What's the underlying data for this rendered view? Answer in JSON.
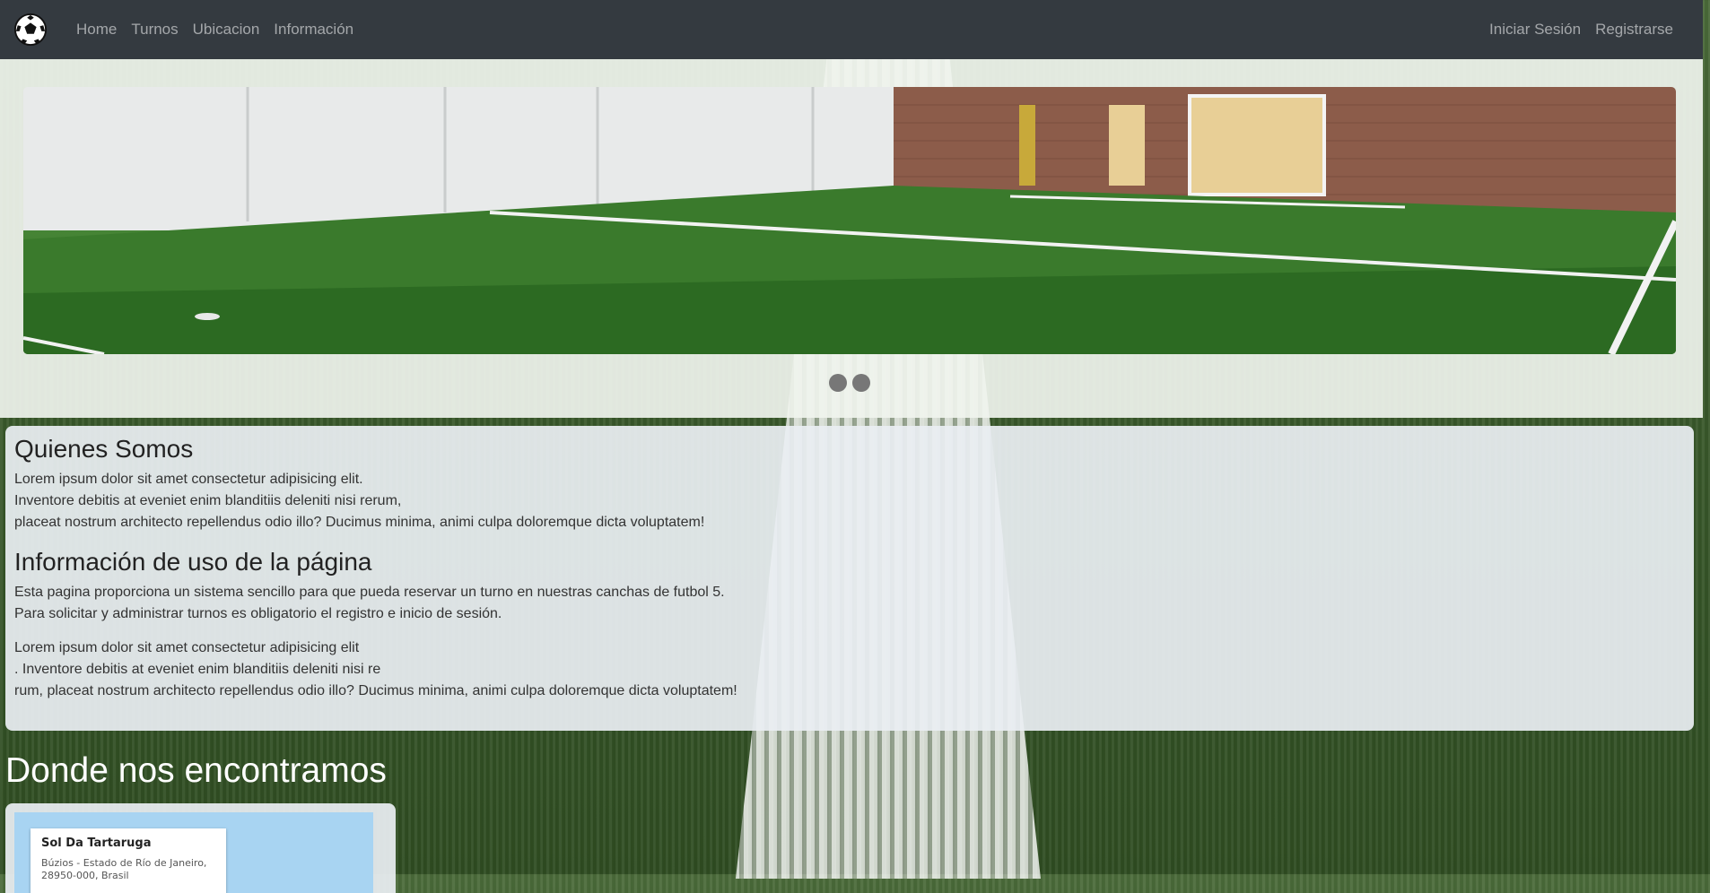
{
  "navbar": {
    "left_links": [
      "Home",
      "Turnos",
      "Ubicacion",
      "Información"
    ],
    "right_links": [
      "Iniciar Sesión",
      "Registrarse"
    ]
  },
  "carousel": {
    "slides": 2,
    "active_index": 0
  },
  "info": {
    "about_title": "Quienes Somos",
    "about_lines": [
      "Lorem ipsum dolor sit amet consectetur adipisicing elit.",
      "Inventore debitis at eveniet enim blanditiis deleniti nisi rerum,",
      "placeat nostrum architecto repellendus odio illo? Ducimus minima, animi culpa doloremque dicta voluptatem!"
    ],
    "usage_title": "Información de uso de la página",
    "usage_lines": [
      "Esta pagina proporciona un sistema sencillo para que pueda reservar un turno en nuestras canchas de futbol 5.",
      "Para solicitar y administrar turnos es obligatorio el registro e inicio de sesión."
    ],
    "extra_lines": [
      "Lorem ipsum dolor sit amet consectetur adipisicing elit",
      ". Inventore debitis at eveniet enim blanditiis deleniti nisi re",
      "rum, placeat nostrum architecto repellendus odio illo? Ducimus minima, animi culpa doloremque dicta voluptatem!"
    ]
  },
  "location": {
    "title": "Donde nos encontramos",
    "place_name": "Sol Da Tartaruga",
    "address_line1": "Búzios - Estado de Río de Janeiro,",
    "address_line2": "28950-000, Brasil"
  }
}
